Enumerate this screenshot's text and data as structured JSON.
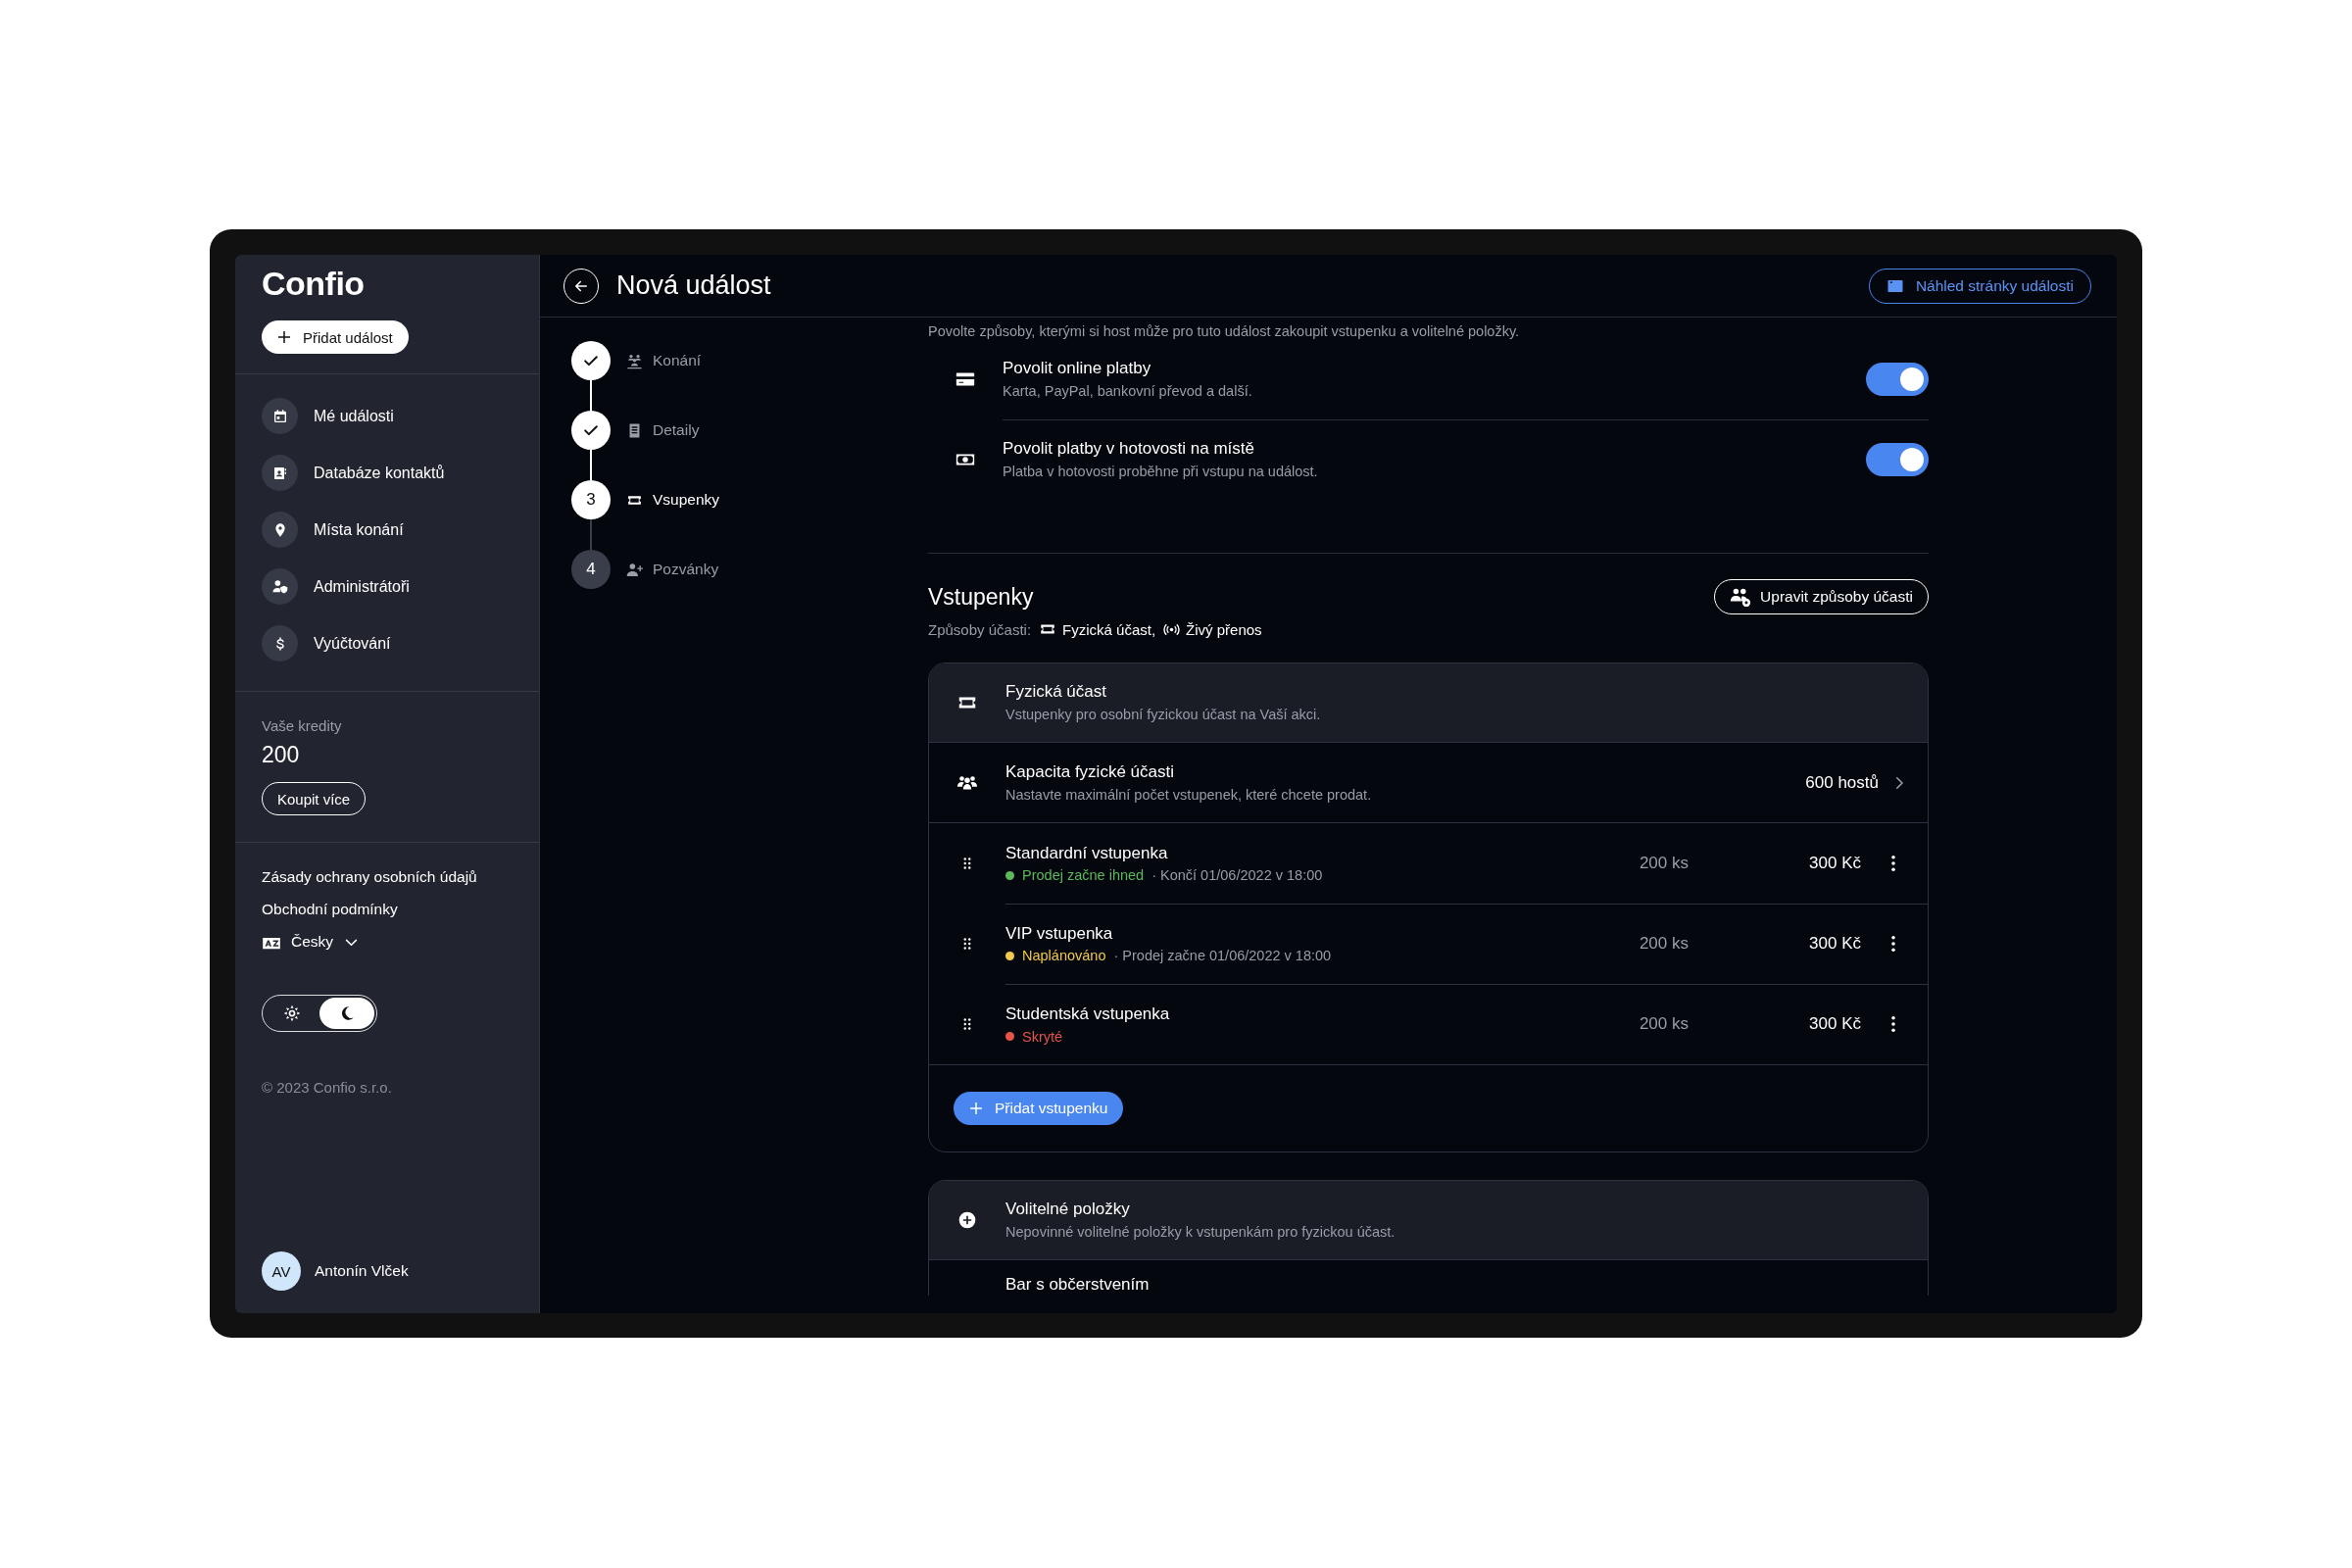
{
  "app": {
    "logo": "Confio",
    "add_button": "Přidat událost"
  },
  "sidebar": {
    "items": [
      {
        "label": "Mé události"
      },
      {
        "label": "Databáze kontaktů"
      },
      {
        "label": "Místa konání"
      },
      {
        "label": "Administrátoři"
      },
      {
        "label": "Vyúčtování"
      }
    ]
  },
  "credits": {
    "label": "Vaše kredity",
    "value": "200",
    "button": "Koupit více"
  },
  "links": [
    "Zásady ochrany osobních údajů",
    "Obchodní podmínky"
  ],
  "language": {
    "label": "Česky"
  },
  "theme": {
    "options": [
      {
        "kind": "light",
        "selected": false
      },
      {
        "kind": "dark",
        "selected": true
      }
    ]
  },
  "copyright": "© 2023 Confio s.r.o.",
  "user": {
    "initials": "AV",
    "name": "Antonín Vlček"
  },
  "header": {
    "title": "Nová událost",
    "preview_button": "Náhled stránky události"
  },
  "steps": [
    {
      "label": "Konání",
      "done": true,
      "selected": false
    },
    {
      "label": "Detaily",
      "done": true,
      "selected": false
    },
    {
      "label": "Vsupenky",
      "number": "3",
      "done": false,
      "selected": true
    },
    {
      "label": "Pozvánky",
      "number": "4",
      "done": false,
      "selected": false
    }
  ],
  "payments": {
    "description": "Povolte způsoby, kterými si host může pro tuto událost zakoupit vstupenku a volitelné položky.",
    "options": [
      {
        "title": "Povolit online platby",
        "subtitle": "Karta, PayPal, bankovní převod a další.",
        "on": true
      },
      {
        "title": "Povolit platby v hotovosti na místě",
        "subtitle": "Platba v hotovosti proběhne při vstupu na událost.",
        "on": true
      }
    ]
  },
  "tickets": {
    "title": "Vstupenky",
    "modes_label": "Způsoby účasti:",
    "modes": [
      "Fyzická účast,",
      "Živý přenos"
    ],
    "edit_button": "Upravit způsoby účasti",
    "card": {
      "title": "Fyzická účast",
      "subtitle": "Vstupenky pro osobní fyzickou účast na Vaší akci.",
      "capacity": {
        "title": "Kapacita fyzické účasti",
        "subtitle": "Nastavte maximální počet vstupenek, které chcete prodat.",
        "value": "600 hostů"
      },
      "rows": [
        {
          "name": "Standardní vstupenka",
          "status": "Prodej začne ihned",
          "color": "#5cb85c",
          "detail": "· Končí 01/06/2022 v 18:00",
          "quantity": "200 ks",
          "price": "300 Kč"
        },
        {
          "name": "VIP vstupenka",
          "status": "Naplánováno",
          "color": "#f2c94c",
          "detail": "· Prodej začne 01/06/2022 v 18:00",
          "quantity": "200 ks",
          "price": "300 Kč"
        },
        {
          "name": "Studentská vstupenka",
          "status": "Skryté",
          "color": "#e5534b",
          "quantity": "200 ks",
          "price": "300 Kč"
        }
      ],
      "add_button": "Přidat vstupenku"
    }
  },
  "optional": {
    "title": "Volitelné položky",
    "subtitle": "Nepovinné volitelné položky k vstupenkám pro fyzickou účast.",
    "rows": [
      {
        "name": "Bar s občerstvením"
      }
    ]
  }
}
